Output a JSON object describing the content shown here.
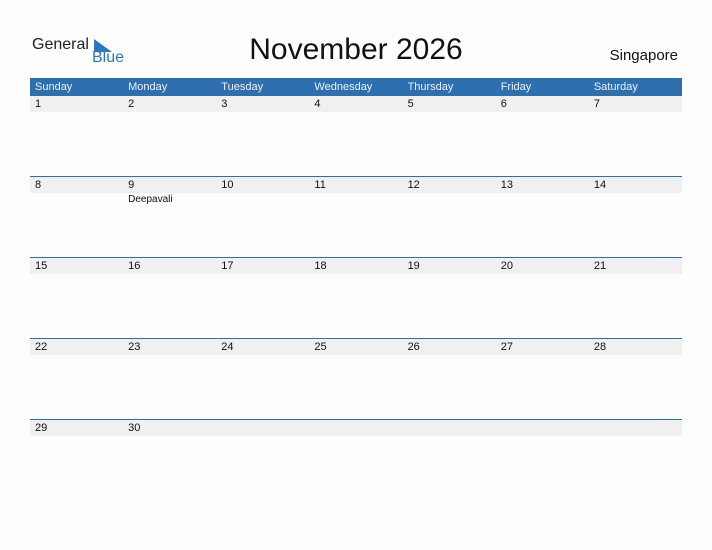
{
  "logo": {
    "general": "General",
    "blue": "Blue",
    "icon": "triangle-flag-icon",
    "brand_color": "#2a78c0"
  },
  "title": "November 2026",
  "country": "Singapore",
  "header_color": "#2e6fb0",
  "weekdays": [
    "Sunday",
    "Monday",
    "Tuesday",
    "Wednesday",
    "Thursday",
    "Friday",
    "Saturday"
  ],
  "weeks": [
    [
      {
        "day": "1"
      },
      {
        "day": "2"
      },
      {
        "day": "3"
      },
      {
        "day": "4"
      },
      {
        "day": "5"
      },
      {
        "day": "6"
      },
      {
        "day": "7"
      }
    ],
    [
      {
        "day": "8"
      },
      {
        "day": "9",
        "event": "Deepavali"
      },
      {
        "day": "10"
      },
      {
        "day": "11"
      },
      {
        "day": "12"
      },
      {
        "day": "13"
      },
      {
        "day": "14"
      }
    ],
    [
      {
        "day": "15"
      },
      {
        "day": "16"
      },
      {
        "day": "17"
      },
      {
        "day": "18"
      },
      {
        "day": "19"
      },
      {
        "day": "20"
      },
      {
        "day": "21"
      }
    ],
    [
      {
        "day": "22"
      },
      {
        "day": "23"
      },
      {
        "day": "24"
      },
      {
        "day": "25"
      },
      {
        "day": "26"
      },
      {
        "day": "27"
      },
      {
        "day": "28"
      }
    ],
    [
      {
        "day": "29"
      },
      {
        "day": "30"
      },
      {
        "day": ""
      },
      {
        "day": ""
      },
      {
        "day": ""
      },
      {
        "day": ""
      },
      {
        "day": ""
      }
    ]
  ]
}
